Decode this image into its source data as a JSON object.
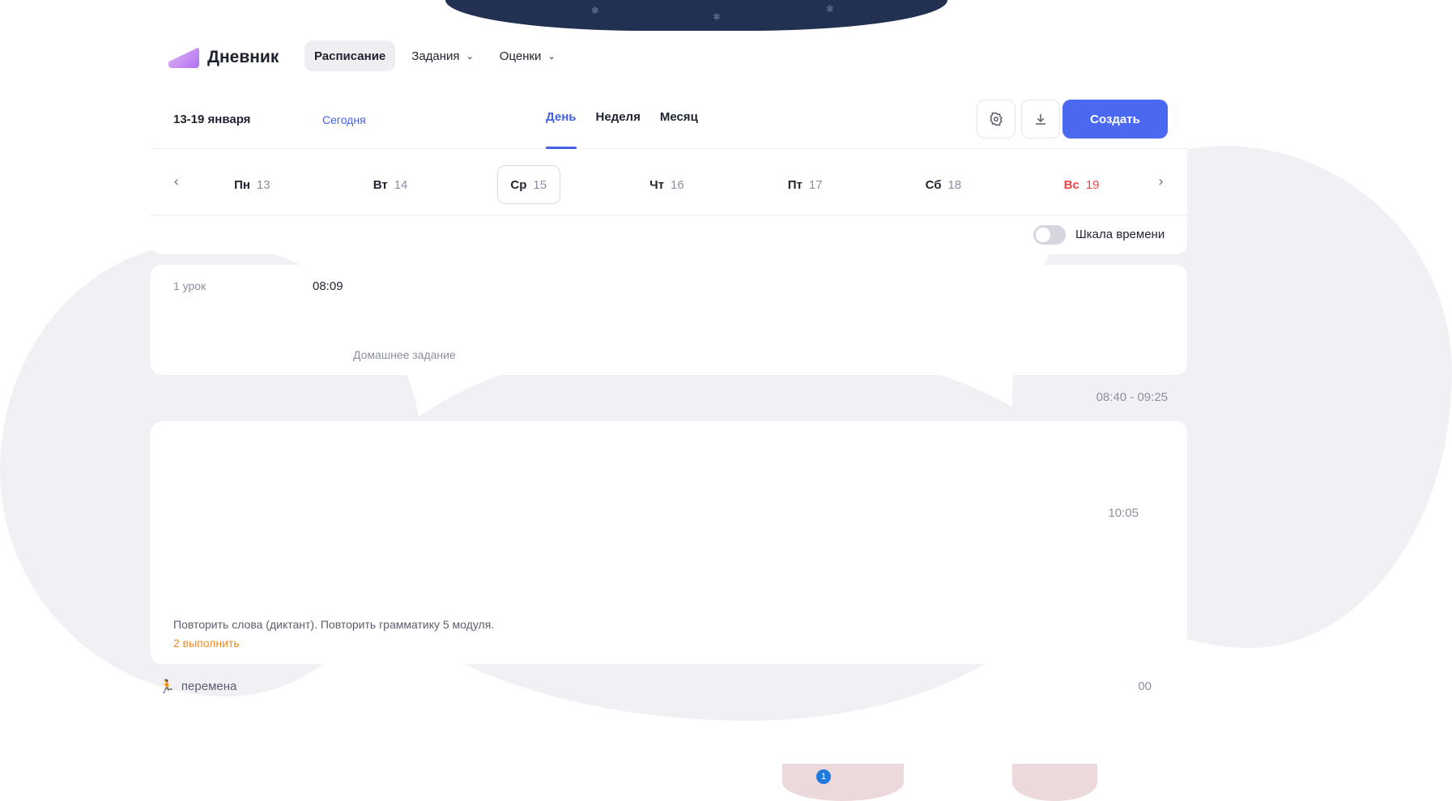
{
  "brand": {
    "name": "Дневник"
  },
  "nav": [
    {
      "label": "Расписание",
      "active": true,
      "has_dropdown": false
    },
    {
      "label": "Задания",
      "active": false,
      "has_dropdown": true
    },
    {
      "label": "Оценки",
      "active": false,
      "has_dropdown": true
    }
  ],
  "toolbar": {
    "period": "13-19 января",
    "today_label": "Сегодня",
    "view_tabs": [
      {
        "label": "День",
        "active": true
      },
      {
        "label": "Неделя",
        "active": false
      },
      {
        "label": "Месяц",
        "active": false
      }
    ],
    "primary_button_label": "Создать"
  },
  "daybar": {
    "days": [
      {
        "name": "Пн",
        "num": "13",
        "selected": false,
        "weekend": false
      },
      {
        "name": "Вт",
        "num": "14",
        "selected": false,
        "weekend": false
      },
      {
        "name": "Ср",
        "num": "15",
        "selected": true,
        "weekend": false
      },
      {
        "name": "Чт",
        "num": "16",
        "selected": false,
        "weekend": false
      },
      {
        "name": "Пт",
        "num": "17",
        "selected": false,
        "weekend": false
      },
      {
        "name": "Сб",
        "num": "18",
        "selected": false,
        "weekend": true
      },
      {
        "name": "Вс",
        "num": "19",
        "selected": false,
        "weekend": true
      }
    ]
  },
  "timeline_toggle_label": "Шкала времени",
  "lessons": [
    {
      "number": "1 урок",
      "time_label": "08:09",
      "subject": "",
      "note": "Домашнее задание"
    },
    {
      "number": "",
      "time_label": "08:40 - 09:25",
      "subject": "",
      "note": ""
    },
    {
      "number": "",
      "time_label": "10:05",
      "subject": "",
      "note": ""
    },
    {
      "number": "",
      "time_label": "",
      "subject": "",
      "homework": "Повторить слова (диктант). Повторить грамматику 5 модуля.",
      "todo": "2 выполнить"
    }
  ],
  "break": {
    "label": "перемена",
    "time": "00"
  },
  "colors": {
    "accent": "#4460e6",
    "weekend": "#f04242",
    "todo": "#f08a24",
    "background_blob": "#f1f1f5"
  },
  "icons": [
    "settings-icon",
    "download-icon",
    "chevron-left-icon",
    "chevron-right-icon",
    "running-icon"
  ],
  "notification_count": "1"
}
